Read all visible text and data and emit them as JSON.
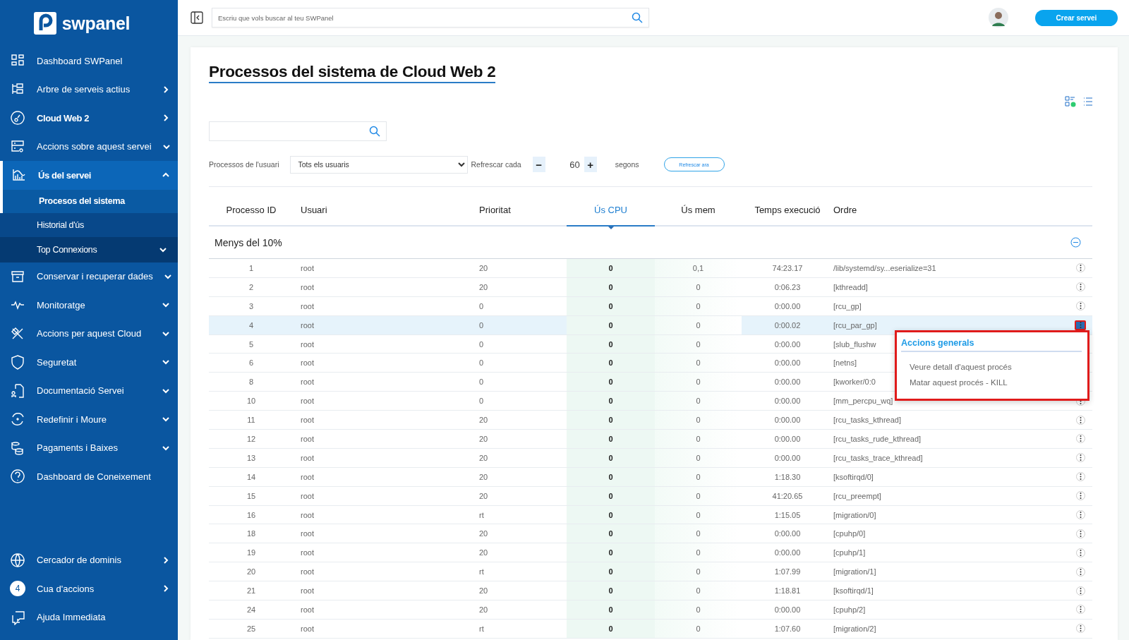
{
  "sidebar": {
    "logo": "swpanel",
    "items": [
      {
        "label": "Dashboard SWPanel",
        "kind": "link",
        "selected": false,
        "emphasized": false
      },
      {
        "label": "Arbre de serveis actius",
        "kind": "submenu",
        "selected": false,
        "emphasized": false
      },
      {
        "label": "Cloud Web 2",
        "kind": "submenu",
        "selected": false,
        "emphasized": true
      },
      {
        "label": "Accions sobre aquest servei",
        "kind": "group",
        "expanded": false,
        "selected": false,
        "emphasized": false
      },
      {
        "label": "Ús del servei",
        "kind": "group",
        "expanded": true,
        "selected": true,
        "emphasized": true,
        "children": [
          {
            "label": "Procesos del sistema",
            "kind": "link",
            "selected": true
          },
          {
            "label": "Historial d'ús",
            "kind": "link",
            "selected": false
          },
          {
            "label": "Top Connexions",
            "kind": "group",
            "expanded": false,
            "selected": false
          }
        ]
      },
      {
        "label": "Conservar i recuperar dades",
        "kind": "group",
        "expanded": false,
        "selected": false,
        "emphasized": false
      },
      {
        "label": "Monitoratge",
        "kind": "group",
        "expanded": false,
        "selected": false,
        "emphasized": false
      },
      {
        "label": "Accions per aquest Cloud",
        "kind": "group",
        "expanded": false,
        "selected": false,
        "emphasized": false
      },
      {
        "label": "Seguretat",
        "kind": "group",
        "expanded": false,
        "selected": false,
        "emphasized": false
      },
      {
        "label": "Documentació Servei",
        "kind": "group",
        "expanded": false,
        "selected": false,
        "emphasized": false
      },
      {
        "label": "Redefinir i Moure",
        "kind": "group",
        "expanded": false,
        "selected": false,
        "emphasized": false
      },
      {
        "label": "Pagaments i Baixes",
        "kind": "group",
        "expanded": false,
        "selected": false,
        "emphasized": false
      },
      {
        "label": "Dashboard de Coneixement",
        "kind": "link",
        "selected": false,
        "emphasized": false
      }
    ],
    "bottom_items": [
      {
        "label": "Cercador de dominis",
        "kind": "submenu"
      },
      {
        "label": "Cua d'accions",
        "kind": "submenu",
        "badge": "4"
      },
      {
        "label": "Ajuda Immediata",
        "kind": "link"
      }
    ]
  },
  "header": {
    "search": {
      "placeholder": "Escriu que vols buscar al teu SWPanel"
    },
    "create_button": "Crear servei"
  },
  "page": {
    "title": "Processos del sistema de Cloud Web 2",
    "controls": {
      "user_label": "Processos de l'usuari",
      "user_select": "Tots els usuaris",
      "refresh_label": "Refrescar cada",
      "decrement": "−",
      "interval": "60",
      "increment": "+",
      "unit": "segons",
      "refresh_button": "Refrescar ara"
    },
    "table": {
      "columns": [
        {
          "label": "Processo ID",
          "sorted": false
        },
        {
          "label": "Usuari",
          "sorted": false
        },
        {
          "label": "Prioritat",
          "sorted": false
        },
        {
          "label": "Ús CPU",
          "sorted": true
        },
        {
          "label": "Ús mem",
          "sorted": false
        },
        {
          "label": "Temps execució",
          "sorted": false
        },
        {
          "label": "Ordre",
          "sorted": false
        }
      ],
      "group": {
        "label": "Menys del 10%",
        "expanded": true
      },
      "rows": [
        {
          "id": "1",
          "user": "root",
          "priority": "20",
          "cpu": "0",
          "mem": "0,1",
          "time": "74:23.17",
          "command": "/lib/systemd/sy...eserialize=31",
          "selected": false,
          "menu_open": false
        },
        {
          "id": "2",
          "user": "root",
          "priority": "20",
          "cpu": "0",
          "mem": "0",
          "time": "0:06.23",
          "command": "[kthreadd]",
          "selected": false,
          "menu_open": false
        },
        {
          "id": "3",
          "user": "root",
          "priority": "0",
          "cpu": "0",
          "mem": "0",
          "time": "0:00.00",
          "command": "[rcu_gp]",
          "selected": false,
          "menu_open": false
        },
        {
          "id": "4",
          "user": "root",
          "priority": "0",
          "cpu": "0",
          "mem": "0",
          "time": "0:00.02",
          "command": "[rcu_par_gp]",
          "selected": true,
          "menu_open": true
        },
        {
          "id": "5",
          "user": "root",
          "priority": "0",
          "cpu": "0",
          "mem": "0",
          "time": "0:00.00",
          "command": "[slub_flushw",
          "selected": false,
          "menu_open": false
        },
        {
          "id": "6",
          "user": "root",
          "priority": "0",
          "cpu": "0",
          "mem": "0",
          "time": "0:00.00",
          "command": "[netns]",
          "selected": false,
          "menu_open": false
        },
        {
          "id": "8",
          "user": "root",
          "priority": "0",
          "cpu": "0",
          "mem": "0",
          "time": "0:00.00",
          "command": "[kworker/0:0",
          "selected": false,
          "menu_open": false
        },
        {
          "id": "10",
          "user": "root",
          "priority": "0",
          "cpu": "0",
          "mem": "0",
          "time": "0:00.00",
          "command": "[mm_percpu_wq]",
          "selected": false,
          "menu_open": false
        },
        {
          "id": "11",
          "user": "root",
          "priority": "20",
          "cpu": "0",
          "mem": "0",
          "time": "0:00.00",
          "command": "[rcu_tasks_kthread]",
          "selected": false,
          "menu_open": false
        },
        {
          "id": "12",
          "user": "root",
          "priority": "20",
          "cpu": "0",
          "mem": "0",
          "time": "0:00.00",
          "command": "[rcu_tasks_rude_kthread]",
          "selected": false,
          "menu_open": false
        },
        {
          "id": "13",
          "user": "root",
          "priority": "20",
          "cpu": "0",
          "mem": "0",
          "time": "0:00.00",
          "command": "[rcu_tasks_trace_kthread]",
          "selected": false,
          "menu_open": false
        },
        {
          "id": "14",
          "user": "root",
          "priority": "20",
          "cpu": "0",
          "mem": "0",
          "time": "1:18.30",
          "command": "[ksoftirqd/0]",
          "selected": false,
          "menu_open": false
        },
        {
          "id": "15",
          "user": "root",
          "priority": "20",
          "cpu": "0",
          "mem": "0",
          "time": "41:20.65",
          "command": "[rcu_preempt]",
          "selected": false,
          "menu_open": false
        },
        {
          "id": "16",
          "user": "root",
          "priority": "rt",
          "cpu": "0",
          "mem": "0",
          "time": "1:15.05",
          "command": "[migration/0]",
          "selected": false,
          "menu_open": false
        },
        {
          "id": "18",
          "user": "root",
          "priority": "20",
          "cpu": "0",
          "mem": "0",
          "time": "0:00.00",
          "command": "[cpuhp/0]",
          "selected": false,
          "menu_open": false
        },
        {
          "id": "19",
          "user": "root",
          "priority": "20",
          "cpu": "0",
          "mem": "0",
          "time": "0:00.00",
          "command": "[cpuhp/1]",
          "selected": false,
          "menu_open": false
        },
        {
          "id": "20",
          "user": "root",
          "priority": "rt",
          "cpu": "0",
          "mem": "0",
          "time": "1:07.99",
          "command": "[migration/1]",
          "selected": false,
          "menu_open": false
        },
        {
          "id": "21",
          "user": "root",
          "priority": "20",
          "cpu": "0",
          "mem": "0",
          "time": "1:18.81",
          "command": "[ksoftirqd/1]",
          "selected": false,
          "menu_open": false
        },
        {
          "id": "24",
          "user": "root",
          "priority": "20",
          "cpu": "0",
          "mem": "0",
          "time": "0:00.00",
          "command": "[cpuhp/2]",
          "selected": false,
          "menu_open": false
        },
        {
          "id": "25",
          "user": "root",
          "priority": "rt",
          "cpu": "0",
          "mem": "0",
          "time": "1:07.60",
          "command": "[migration/2]",
          "selected": false,
          "menu_open": false
        }
      ]
    },
    "action_menu": {
      "title": "Accions generals",
      "items": [
        "Veure detall d'aquest procés",
        "Matar aquest procés - KILL"
      ]
    }
  }
}
